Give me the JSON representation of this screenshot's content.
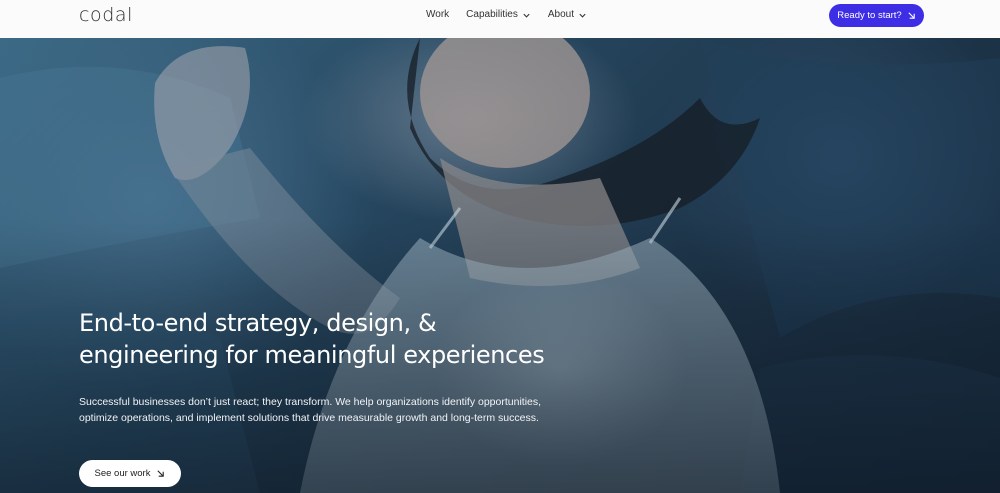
{
  "nav": {
    "logo": "codal",
    "items": [
      {
        "label": "Work",
        "has_dropdown": false
      },
      {
        "label": "Capabilities",
        "has_dropdown": true
      },
      {
        "label": "About",
        "has_dropdown": true
      }
    ],
    "cta_label": "Ready to start?",
    "cta_icon": "arrow-down-right-icon",
    "cta_color": "#3d2ee6"
  },
  "hero": {
    "headline_line1": "End-to-end strategy, design, &",
    "headline_line2": "engineering for meaningful experiences",
    "body": "Successful businesses don’t just react; they transform. We help organizations identify opportunities, optimize operations, and implement solutions that drive measurable growth and long-term success.",
    "button_label": "See our work",
    "button_icon": "arrow-down-right-icon",
    "image": "woman-sleeping-in-bed-photo"
  }
}
